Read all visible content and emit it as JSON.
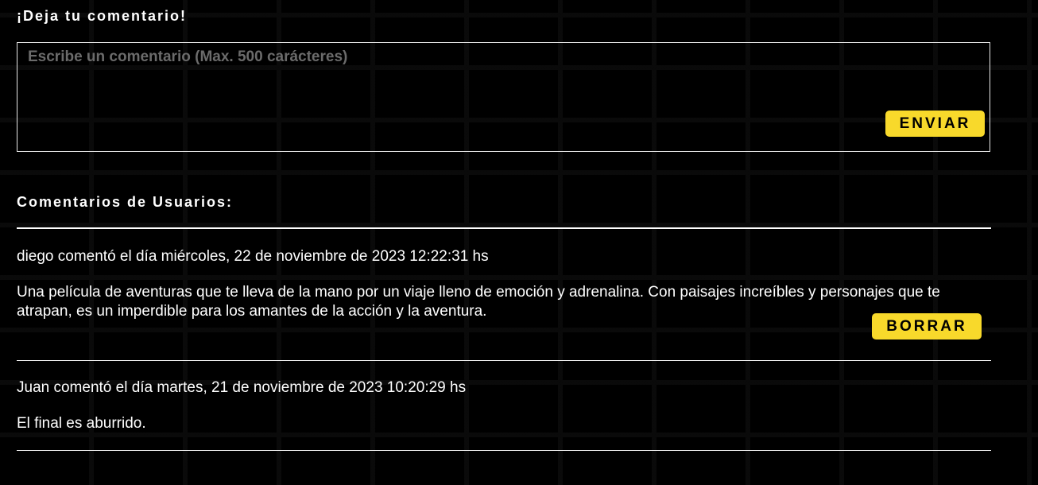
{
  "form": {
    "title": "¡Deja tu comentario!",
    "placeholder": "Escribe un comentario (Max. 500 carácteres)",
    "value": "",
    "send_label": "ENVIAR"
  },
  "comments_section": {
    "title": "Comentarios de Usuarios:",
    "comments": [
      {
        "meta": "diego comentó el día miércoles, 22 de noviembre de 2023 12:22:31 hs",
        "body": "Una película de aventuras que te lleva de la mano por un viaje lleno de emoción y adrenalina. Con paisajes increíbles y personajes que te atrapan, es un imperdible para los amantes de la acción y la aventura.",
        "delete_label": "BORRAR"
      },
      {
        "meta": "Juan comentó el día martes, 21 de noviembre de 2023 10:20:29 hs",
        "body": "El final es aburrido."
      }
    ]
  },
  "colors": {
    "background": "#000000",
    "accent": "#f8d92b",
    "text": "#ffffff",
    "placeholder": "#6b6b6b"
  }
}
